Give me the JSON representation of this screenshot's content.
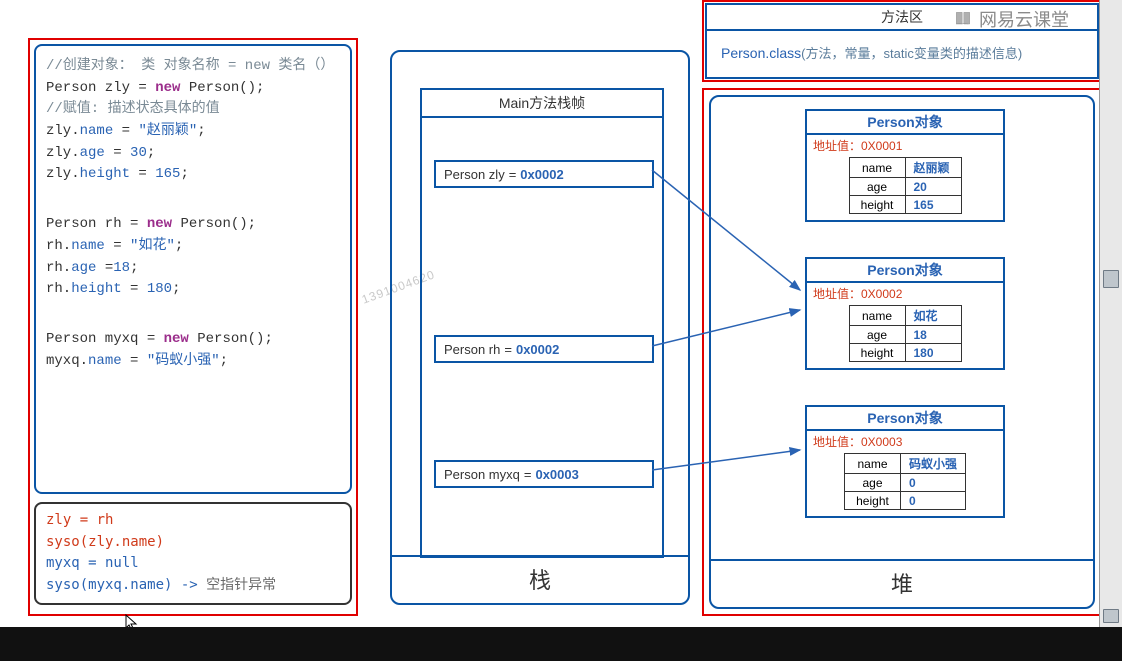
{
  "watermark": {
    "logo_text": "网易云课堂",
    "number": "1391004620"
  },
  "code": {
    "comment1": "//创建对象：  类 对象名称 = new 类名（）",
    "l2_a": "Person zly = ",
    "l2_kw": "new",
    "l2_b": " Person();",
    "comment2": "//赋值: 描述状态具体的值",
    "l4_a": "zly.",
    "l4_p": "name",
    "l4_b": " = ",
    "l4_v": "\"赵丽颖\"",
    "l4_c": ";",
    "l5_a": "zly.",
    "l5_p": "age",
    "l5_b": " = ",
    "l5_v": "30",
    "l5_c": ";",
    "l6_a": "zly.",
    "l6_p": "height",
    "l6_b": " = ",
    "l6_v": "165",
    "l6_c": ";",
    "l8_a": "Person rh = ",
    "l8_kw": "new",
    "l8_b": " Person();",
    "l9_a": "rh.",
    "l9_p": "name",
    "l9_b": " = ",
    "l9_v": "\"如花\"",
    "l9_c": ";",
    "l10_a": "rh.",
    "l10_p": "age",
    "l10_b": " =",
    "l10_v": "18",
    "l10_c": ";",
    "l11_a": "rh.",
    "l11_p": "height",
    "l11_b": " = ",
    "l11_v": "180",
    "l11_c": ";",
    "l13_a": "Person myxq = ",
    "l13_kw": "new",
    "l13_b": " Person();",
    "l14_a": "myxq.",
    "l14_p": "name",
    "l14_b": " = ",
    "l14_v": "\"码蚁小强\"",
    "l14_c": ";"
  },
  "notes": {
    "l1": "zly = rh",
    "l2": "syso(zly.name)",
    "l3": "myxq = null",
    "l4a": "syso(myxq.name)   -> ",
    "l4b": "空指针异常"
  },
  "stack": {
    "title": "栈",
    "frame_header": "Main方法栈帧",
    "vars": [
      {
        "label": "Person zly",
        "addr": "0x0002"
      },
      {
        "label": "Person rh",
        "addr": "0x0002"
      },
      {
        "label": "Person myxq",
        "addr": "0x0003"
      }
    ]
  },
  "method_area": {
    "title": "方法区",
    "cls": "Person.class",
    "desc": "(方法，常量，static变量类的描述信息)"
  },
  "heap": {
    "title": "堆",
    "objects": [
      {
        "title": "Person对象",
        "addr_label": "地址值：0X0001",
        "rows": [
          {
            "k": "name",
            "v": "赵丽颖"
          },
          {
            "k": "age",
            "v": "20"
          },
          {
            "k": "height",
            "v": "165"
          }
        ]
      },
      {
        "title": "Person对象",
        "addr_label": "地址值：0X0002",
        "rows": [
          {
            "k": "name",
            "v": "如花"
          },
          {
            "k": "age",
            "v": "18"
          },
          {
            "k": "height",
            "v": "180"
          }
        ]
      },
      {
        "title": "Person对象",
        "addr_label": "地址值：0X0003",
        "rows": [
          {
            "k": "name",
            "v": "码蚁小强"
          },
          {
            "k": "age",
            "v": "0"
          },
          {
            "k": "height",
            "v": "0"
          }
        ]
      }
    ]
  }
}
